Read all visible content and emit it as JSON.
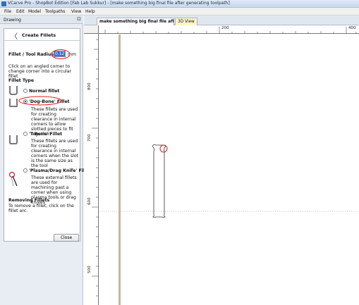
{
  "window": {
    "title": "VCarve Pro - ShopBot Edition [Fab Lab Sukkur] - [make something big final file after generating toolpath]"
  },
  "menu": [
    "File",
    "Edit",
    "Model",
    "Toolpaths",
    "View",
    "Help"
  ],
  "panel": {
    "header": "Drawing",
    "pin_glyph": "⊡",
    "form": {
      "back_glyph": "〈",
      "title": "Create Fillets",
      "radius_label": "Fillet / Tool Radius:",
      "radius_value": "0.125",
      "radius_unit": "mm",
      "instructions": "Click on an angled corner to change corner into a circular fillet",
      "fillet_type_heading": "Fillet Type",
      "options": [
        {
          "label": "Normal fillet",
          "selected": false,
          "icon": "normal-fillet-icon",
          "description": ""
        },
        {
          "label": "'Dog-Bone' Fillet",
          "selected": true,
          "icon": "dog-bone-fillet-icon",
          "description": "These fillets are used for creating clearance in internal corners to allow slotted pieces to fit together."
        },
        {
          "label": "'T-Bone' Fillet",
          "selected": false,
          "icon": "t-bone-fillet-icon",
          "description": "These fillets are used for creating clearance in internal corners when the slot is the same size as the tool"
        },
        {
          "label": "'Plasma/Drag Knife' Fillet",
          "selected": false,
          "icon": "drag-knife-fillet-icon",
          "description": "These external fillets are used for machining past a corner when using plasma tools or drag knives"
        }
      ],
      "removing_heading": "Removing Fillets",
      "removing_text": "To remove a fillet, click on the fillet arc.",
      "close_label": "Close"
    }
  },
  "document": {
    "tabs": [
      {
        "label": "make something big final file afte...",
        "active": true
      },
      {
        "label": "3D View",
        "active": false
      }
    ],
    "ruler_top_labels": [
      "200",
      "400"
    ],
    "ruler_left_labels": [
      "800",
      "700",
      "600",
      "500"
    ],
    "highlight_color": "#e01b1b",
    "material_edge_color": "#c8b79a"
  }
}
